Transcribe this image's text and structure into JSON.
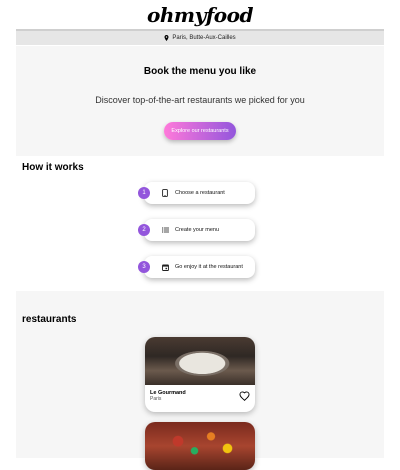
{
  "header": {
    "logo": "ohmyfood"
  },
  "location": {
    "text": "Paris, Butte-Aux-Cailles",
    "icon": "map-pin-icon"
  },
  "hero": {
    "title": "Book the menu you like",
    "subtitle": "Discover top-of-the-art restaurants we picked for you",
    "button": "Explore our restaurants"
  },
  "how_it_works": {
    "title": "How it works",
    "steps": [
      {
        "number": "1",
        "label": "Choose a restaurant",
        "icon": "phone-icon"
      },
      {
        "number": "2",
        "label": "Create your menu",
        "icon": "list-icon"
      },
      {
        "number": "3",
        "label": "Go enjoy it at the restaurant",
        "icon": "calendar-icon"
      }
    ]
  },
  "restaurants": {
    "title": "restaurants",
    "items": [
      {
        "name": "Le Gourmand",
        "city": "Paris",
        "icon": "heart-icon"
      },
      {
        "name": "",
        "city": ""
      }
    ]
  },
  "colors": {
    "accent_start": "#ff79da",
    "accent_end": "#9356dc",
    "step_badge": "#9356dc"
  }
}
